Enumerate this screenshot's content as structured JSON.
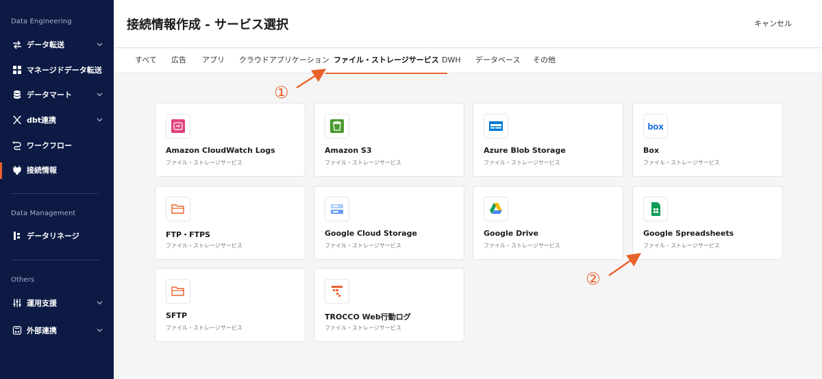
{
  "sidebar": {
    "sections": [
      {
        "title": "Data Engineering"
      },
      {
        "title": "Data Management"
      },
      {
        "title": "Others"
      }
    ],
    "items": [
      {
        "label": "データ転送",
        "icon": "arrows-transfer-icon",
        "has_chevron": true
      },
      {
        "label": "マネージドデータ転送",
        "icon": "grid-icon",
        "has_chevron": false
      },
      {
        "label": "データマート",
        "icon": "database-icon",
        "has_chevron": true
      },
      {
        "label": "dbt連携",
        "icon": "dbt-icon",
        "has_chevron": true
      },
      {
        "label": "ワークフロー",
        "icon": "workflow-icon",
        "has_chevron": false
      },
      {
        "label": "接続情報",
        "icon": "plug-icon",
        "has_chevron": false,
        "active": true
      },
      {
        "label": "データリネージ",
        "icon": "lineage-icon",
        "has_chevron": false
      },
      {
        "label": "運用支援",
        "icon": "sliders-icon",
        "has_chevron": true
      },
      {
        "label": "外部連携",
        "icon": "external-link-icon",
        "has_chevron": true
      }
    ]
  },
  "header": {
    "title": "接続情報作成 - サービス選択",
    "cancel_label": "キャンセル"
  },
  "tabs": [
    {
      "label": "すべて"
    },
    {
      "label": "広告"
    },
    {
      "label": "アプリ"
    },
    {
      "label": "クラウドアプリケーション"
    },
    {
      "label": "ファイル・ストレージサービス",
      "active": true
    },
    {
      "label": "DWH"
    },
    {
      "label": "データベース"
    },
    {
      "label": "その他"
    }
  ],
  "cards": [
    {
      "name": "Amazon CloudWatch Logs",
      "category": "ファイル・ストレージサービス",
      "icon": "cloudwatch-icon"
    },
    {
      "name": "Amazon S3",
      "category": "ファイル・ストレージサービス",
      "icon": "s3-bucket-icon"
    },
    {
      "name": "Azure Blob Storage",
      "category": "ファイル・ストレージサービス",
      "icon": "azure-blob-icon"
    },
    {
      "name": "Box",
      "category": "ファイル・ストレージサービス",
      "icon": "box-logo-icon",
      "logo_text": "box"
    },
    {
      "name": "FTP・FTPS",
      "category": "ファイル・ストレージサービス",
      "icon": "folder-icon"
    },
    {
      "name": "Google Cloud Storage",
      "category": "ファイル・ストレージサービス",
      "icon": "gcs-icon"
    },
    {
      "name": "Google Drive",
      "category": "ファイル・ストレージサービス",
      "icon": "google-drive-icon"
    },
    {
      "name": "Google Spreadsheets",
      "category": "ファイル・ストレージサービス",
      "icon": "google-sheets-icon"
    },
    {
      "name": "SFTP",
      "category": "ファイル・ストレージサービス",
      "icon": "folder-icon"
    },
    {
      "name": "TROCCO Web行動ログ",
      "category": "ファイル・ストレージサービス",
      "icon": "trocco-icon"
    }
  ],
  "annotations": [
    {
      "label": "①"
    },
    {
      "label": "②"
    }
  ],
  "colors": {
    "sidebar_bg": "#0c1a44",
    "accent": "#e8622c",
    "page_bg": "#f5f5f6"
  }
}
